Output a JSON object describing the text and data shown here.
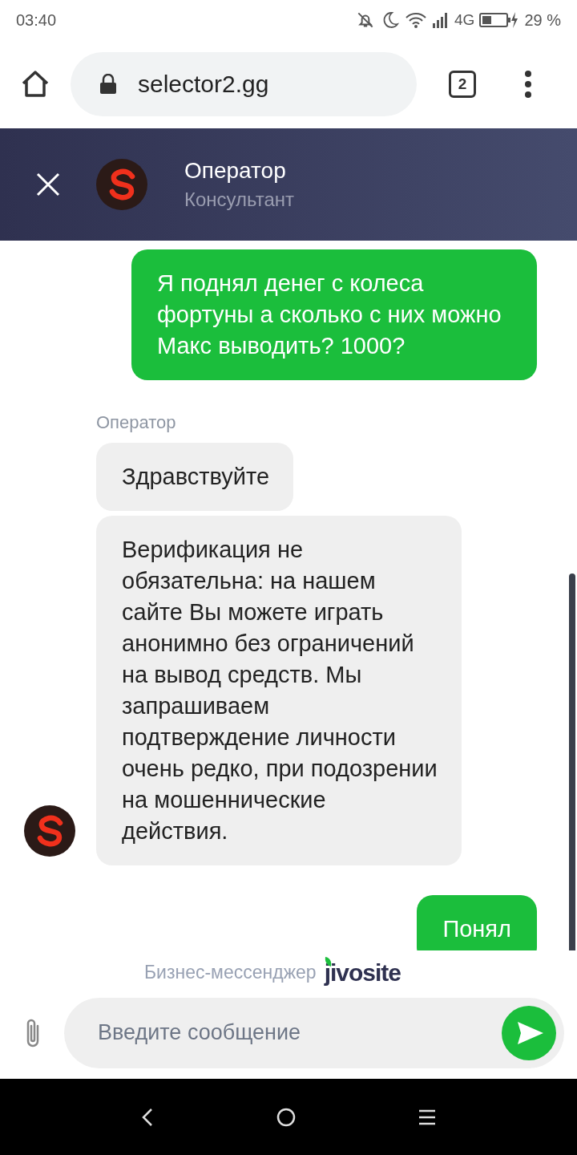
{
  "status_bar": {
    "time": "03:40",
    "network": "4G",
    "battery": "29 %"
  },
  "browser": {
    "url": "selector2.gg",
    "tab_count": "2"
  },
  "chat_header": {
    "name": "Оператор",
    "role": "Консультант"
  },
  "messages": [
    {
      "kind": "outgoing",
      "text": "Я поднял денег с колеса фортуны а сколько с них можно Макс выводить? 1000?"
    },
    {
      "kind": "incoming",
      "sender": "Оператор",
      "bubbles": [
        "Здравствуйте",
        "Верификация не обязательна: на нашем сайте Вы можете играть анонимно без ограничений на вывод средств. Мы запрашиваем подтверждение личности очень редко, при подозрении на мошеннические действия."
      ]
    },
    {
      "kind": "outgoing",
      "text": "Понял"
    }
  ],
  "footer": {
    "label": "Бизнес-мессенджер",
    "brand": "jivosite"
  },
  "composer": {
    "placeholder": "Введите сообщение"
  }
}
